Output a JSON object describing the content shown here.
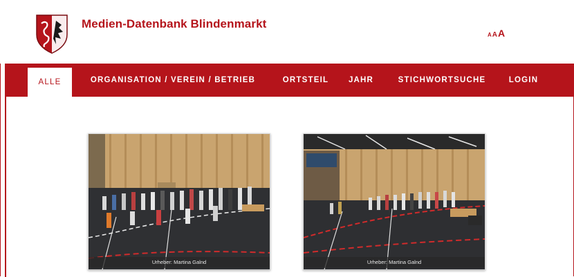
{
  "site": {
    "title": "Medien-Datenbank Blindenmarkt",
    "brand_color": "#b5141b",
    "logo_icon": "coat-of-arms-icon"
  },
  "font_size_controls": [
    "A",
    "A",
    "A"
  ],
  "nav": {
    "items": [
      {
        "label": "ALLE",
        "active": true
      },
      {
        "label": "ORGANISATION / VEREIN / BETRIEB",
        "active": false
      },
      {
        "label": "ORTSTEIL",
        "active": false
      },
      {
        "label": "JAHR",
        "active": false
      },
      {
        "label": "STICHWORTSUCHE",
        "active": false
      },
      {
        "label": "LOGIN",
        "active": false
      }
    ]
  },
  "gallery": {
    "items": [
      {
        "caption": "Urheber: Martina Galnd"
      },
      {
        "caption": "Urheber: Martina Galnd"
      }
    ]
  }
}
